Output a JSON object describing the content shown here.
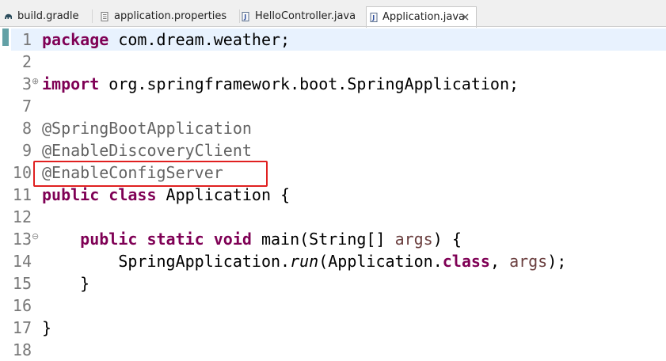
{
  "tabs": [
    {
      "label": "build.gradle",
      "icon": "gradle-elephant-icon",
      "active": false
    },
    {
      "label": "application.properties",
      "icon": "properties-file-icon",
      "active": false
    },
    {
      "label": "HelloController.java",
      "icon": "java-file-icon",
      "active": false
    },
    {
      "label": "Application.java",
      "icon": "java-file-icon",
      "active": true
    }
  ],
  "editor": {
    "lines": [
      {
        "num": "1",
        "segments": [
          {
            "t": "package",
            "c": "kw"
          },
          {
            "t": " com.dream.weather;"
          }
        ]
      },
      {
        "num": "2",
        "segments": []
      },
      {
        "num": "3",
        "fold": "⊕",
        "segments": [
          {
            "t": "import",
            "c": "kw"
          },
          {
            "t": " org.springframework.boot.SpringApplication;"
          }
        ]
      },
      {
        "num": "7",
        "segments": []
      },
      {
        "num": "8",
        "segments": [
          {
            "t": "@SpringBootApplication",
            "c": "ann"
          }
        ]
      },
      {
        "num": "9",
        "segments": [
          {
            "t": "@EnableDiscoveryClient",
            "c": "ann"
          }
        ]
      },
      {
        "num": "10",
        "segments": [
          {
            "t": "@EnableConfigServer",
            "c": "ann"
          }
        ]
      },
      {
        "num": "11",
        "segments": [
          {
            "t": "public",
            "c": "kw"
          },
          {
            "t": " "
          },
          {
            "t": "class",
            "c": "kw"
          },
          {
            "t": " Application {"
          }
        ]
      },
      {
        "num": "12",
        "segments": []
      },
      {
        "num": "13",
        "fold": "⊖",
        "segments": [
          {
            "t": "    "
          },
          {
            "t": "public",
            "c": "kw"
          },
          {
            "t": " "
          },
          {
            "t": "static",
            "c": "kw"
          },
          {
            "t": " "
          },
          {
            "t": "void",
            "c": "kw"
          },
          {
            "t": " main(String[] "
          },
          {
            "t": "args",
            "c": "param"
          },
          {
            "t": ") {"
          }
        ]
      },
      {
        "num": "14",
        "segments": [
          {
            "t": "        SpringApplication."
          },
          {
            "t": "run",
            "c": "it"
          },
          {
            "t": "(Application."
          },
          {
            "t": "class",
            "c": "kw"
          },
          {
            "t": ", "
          },
          {
            "t": "args",
            "c": "param"
          },
          {
            "t": ");"
          }
        ]
      },
      {
        "num": "15",
        "segments": [
          {
            "t": "    }"
          }
        ]
      },
      {
        "num": "16",
        "segments": []
      },
      {
        "num": "17",
        "segments": [
          {
            "t": "}"
          }
        ]
      },
      {
        "num": "18",
        "segments": []
      }
    ]
  },
  "colors": {
    "keyword": "#7f0055",
    "annotation": "#646464",
    "parameter": "#6a3e3e",
    "line_number": "#787878",
    "highlight_box": "#e02020",
    "current_line": "#e8f2fe"
  }
}
